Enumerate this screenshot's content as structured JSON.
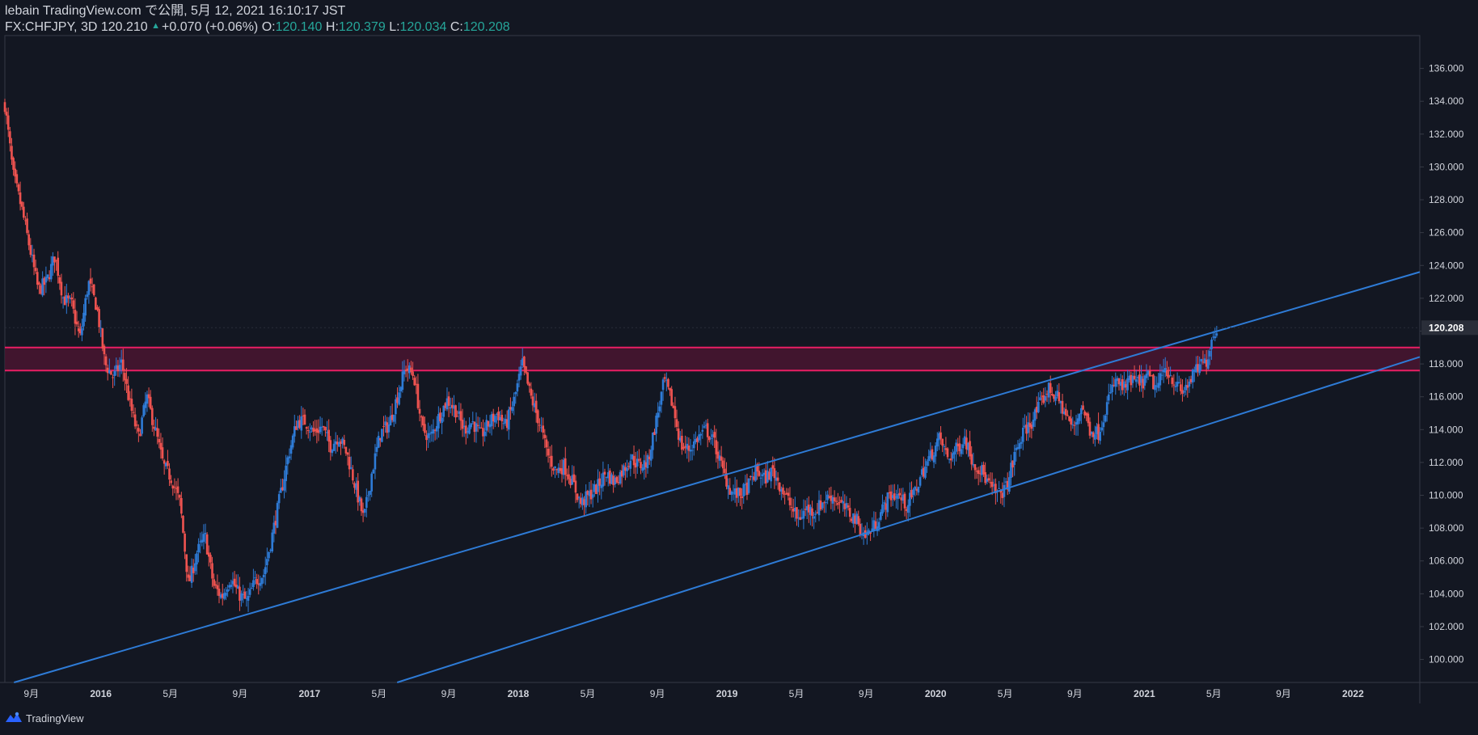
{
  "header": {
    "line1": "lebain TradingView.com で公開, 5月 12, 2021 16:10:17 JST",
    "symbol": "FX:CHFJPY, 3D",
    "price": "120.210",
    "change": "+0.070 (+0.06%)",
    "o_label": "O:",
    "o_value": "120.140",
    "h_label": "H:",
    "h_value": "120.379",
    "l_label": "L:",
    "l_value": "120.034",
    "c_label": "C:",
    "c_value": "120.208"
  },
  "footer": {
    "brand": "TradingView",
    "logo_icon": "tradingview-logo-icon"
  },
  "colors": {
    "background": "#131722",
    "up": "#2e7bd6",
    "down": "#ef5350",
    "trendline": "#2e7bd6",
    "zone_border": "#e91e63",
    "zone_fill": "#4a1530",
    "axis_text": "#d1d4dc",
    "price_tag_bg": "#2a2e39"
  },
  "chart_data": {
    "type": "candlestick",
    "symbol": "FX:CHFJPY",
    "timeframe": "3D",
    "last_price": 120.208,
    "y_axis": {
      "ticks": [
        100,
        102,
        104,
        106,
        108,
        110,
        112,
        114,
        116,
        118,
        120,
        122,
        124,
        126,
        128,
        130,
        132,
        134,
        136
      ],
      "tick_labels": [
        "100.000",
        "102.000",
        "104.000",
        "106.000",
        "108.000",
        "110.000",
        "112.000",
        "114.000",
        "116.000",
        "118.000",
        "120.000",
        "122.000",
        "124.000",
        "126.000",
        "128.000",
        "130.000",
        "132.000",
        "134.000",
        "136.000"
      ],
      "range": [
        98.6,
        138.0
      ]
    },
    "x_axis": {
      "range": [
        2015.54,
        2022.32
      ],
      "ticks": [
        {
          "t": 2015.667,
          "label": "9月"
        },
        {
          "t": 2016.0,
          "label": "2016"
        },
        {
          "t": 2016.333,
          "label": "5月"
        },
        {
          "t": 2016.667,
          "label": "9月"
        },
        {
          "t": 2017.0,
          "label": "2017"
        },
        {
          "t": 2017.333,
          "label": "5月"
        },
        {
          "t": 2017.667,
          "label": "9月"
        },
        {
          "t": 2018.0,
          "label": "2018"
        },
        {
          "t": 2018.333,
          "label": "5月"
        },
        {
          "t": 2018.667,
          "label": "9月"
        },
        {
          "t": 2019.0,
          "label": "2019"
        },
        {
          "t": 2019.333,
          "label": "5月"
        },
        {
          "t": 2019.667,
          "label": "9月"
        },
        {
          "t": 2020.0,
          "label": "2020"
        },
        {
          "t": 2020.333,
          "label": "5月"
        },
        {
          "t": 2020.667,
          "label": "9月"
        },
        {
          "t": 2021.0,
          "label": "2021"
        },
        {
          "t": 2021.333,
          "label": "5月"
        },
        {
          "t": 2021.667,
          "label": "9月"
        },
        {
          "t": 2022.0,
          "label": "2022"
        }
      ]
    },
    "resistance_zone": {
      "low": 117.6,
      "high": 119.0
    },
    "trendlines": [
      {
        "name": "upper",
        "p1": {
          "t": 2016.5,
          "v": 102.0
        },
        "p2": {
          "t": 2021.35,
          "v": 120.0
        }
      },
      {
        "name": "lower",
        "p1": {
          "t": 2017.42,
          "v": 98.6
        },
        "p2": {
          "t": 2021.35,
          "v": 114.5
        }
      }
    ],
    "close_path": [
      [
        2015.54,
        133.8
      ],
      [
        2015.58,
        129.5
      ],
      [
        2015.62,
        127.5
      ],
      [
        2015.66,
        125.0
      ],
      [
        2015.7,
        122.5
      ],
      [
        2015.74,
        123.0
      ],
      [
        2015.78,
        124.6
      ],
      [
        2015.82,
        122.0
      ],
      [
        2015.86,
        121.6
      ],
      [
        2015.9,
        119.5
      ],
      [
        2015.94,
        123.0
      ],
      [
        2015.98,
        121.5
      ],
      [
        2016.02,
        118.0
      ],
      [
        2016.06,
        117.2
      ],
      [
        2016.1,
        118.1
      ],
      [
        2016.14,
        115.5
      ],
      [
        2016.18,
        113.5
      ],
      [
        2016.22,
        116.0
      ],
      [
        2016.26,
        114.0
      ],
      [
        2016.3,
        111.8
      ],
      [
        2016.34,
        111.0
      ],
      [
        2016.38,
        109.5
      ],
      [
        2016.42,
        104.5
      ],
      [
        2016.46,
        106.5
      ],
      [
        2016.5,
        107.5
      ],
      [
        2016.54,
        104.5
      ],
      [
        2016.58,
        103.8
      ],
      [
        2016.62,
        105.0
      ],
      [
        2016.66,
        104.0
      ],
      [
        2016.7,
        103.5
      ],
      [
        2016.74,
        104.8
      ],
      [
        2016.78,
        105.2
      ],
      [
        2016.82,
        107.5
      ],
      [
        2016.86,
        110.0
      ],
      [
        2016.9,
        112.5
      ],
      [
        2016.94,
        114.5
      ],
      [
        2016.98,
        114.5
      ],
      [
        2017.02,
        113.8
      ],
      [
        2017.06,
        114.2
      ],
      [
        2017.1,
        113.0
      ],
      [
        2017.14,
        113.6
      ],
      [
        2017.18,
        112.5
      ],
      [
        2017.22,
        110.5
      ],
      [
        2017.26,
        108.5
      ],
      [
        2017.3,
        111.5
      ],
      [
        2017.34,
        113.8
      ],
      [
        2017.38,
        114.3
      ],
      [
        2017.42,
        116.0
      ],
      [
        2017.46,
        117.8
      ],
      [
        2017.5,
        117.3
      ],
      [
        2017.54,
        114.0
      ],
      [
        2017.58,
        113.5
      ],
      [
        2017.62,
        114.8
      ],
      [
        2017.66,
        115.8
      ],
      [
        2017.7,
        115.2
      ],
      [
        2017.74,
        114.0
      ],
      [
        2017.78,
        114.5
      ],
      [
        2017.82,
        113.6
      ],
      [
        2017.86,
        114.4
      ],
      [
        2017.9,
        115.0
      ],
      [
        2017.94,
        114.2
      ],
      [
        2017.98,
        115.8
      ],
      [
        2018.02,
        118.0
      ],
      [
        2018.06,
        116.0
      ],
      [
        2018.1,
        114.5
      ],
      [
        2018.14,
        112.5
      ],
      [
        2018.18,
        111.5
      ],
      [
        2018.22,
        111.8
      ],
      [
        2018.26,
        110.8
      ],
      [
        2018.3,
        109.5
      ],
      [
        2018.34,
        110.0
      ],
      [
        2018.38,
        110.5
      ],
      [
        2018.42,
        111.4
      ],
      [
        2018.46,
        110.8
      ],
      [
        2018.5,
        111.5
      ],
      [
        2018.54,
        112.3
      ],
      [
        2018.58,
        111.8
      ],
      [
        2018.62,
        112.0
      ],
      [
        2018.66,
        114.5
      ],
      [
        2018.7,
        117.0
      ],
      [
        2018.74,
        115.5
      ],
      [
        2018.78,
        113.0
      ],
      [
        2018.82,
        112.8
      ],
      [
        2018.86,
        113.5
      ],
      [
        2018.9,
        114.0
      ],
      [
        2018.94,
        113.2
      ],
      [
        2018.98,
        111.5
      ],
      [
        2019.02,
        110.2
      ],
      [
        2019.06,
        110.0
      ],
      [
        2019.1,
        110.5
      ],
      [
        2019.14,
        111.5
      ],
      [
        2019.18,
        111.0
      ],
      [
        2019.22,
        111.5
      ],
      [
        2019.26,
        110.5
      ],
      [
        2019.3,
        109.5
      ],
      [
        2019.34,
        108.5
      ],
      [
        2019.38,
        109.2
      ],
      [
        2019.42,
        109.0
      ],
      [
        2019.46,
        109.6
      ],
      [
        2019.5,
        110.0
      ],
      [
        2019.54,
        109.5
      ],
      [
        2019.58,
        109.0
      ],
      [
        2019.62,
        108.5
      ],
      [
        2019.66,
        107.5
      ],
      [
        2019.7,
        108.0
      ],
      [
        2019.74,
        109.0
      ],
      [
        2019.78,
        110.0
      ],
      [
        2019.82,
        110.0
      ],
      [
        2019.86,
        109.4
      ],
      [
        2019.9,
        110.2
      ],
      [
        2019.94,
        111.5
      ],
      [
        2019.98,
        112.5
      ],
      [
        2020.02,
        113.5
      ],
      [
        2020.06,
        112.2
      ],
      [
        2020.1,
        112.8
      ],
      [
        2020.14,
        113.5
      ],
      [
        2020.18,
        112.0
      ],
      [
        2020.22,
        111.5
      ],
      [
        2020.26,
        110.5
      ],
      [
        2020.3,
        110.0
      ],
      [
        2020.34,
        110.5
      ],
      [
        2020.38,
        112.5
      ],
      [
        2020.42,
        113.8
      ],
      [
        2020.46,
        114.5
      ],
      [
        2020.5,
        115.5
      ],
      [
        2020.54,
        116.5
      ],
      [
        2020.58,
        116.0
      ],
      [
        2020.62,
        115.0
      ],
      [
        2020.66,
        114.0
      ],
      [
        2020.7,
        115.5
      ],
      [
        2020.74,
        114.0
      ],
      [
        2020.78,
        113.8
      ],
      [
        2020.82,
        115.5
      ],
      [
        2020.86,
        117.0
      ],
      [
        2020.9,
        116.5
      ],
      [
        2020.94,
        117.0
      ],
      [
        2020.98,
        116.8
      ],
      [
        2021.02,
        117.2
      ],
      [
        2021.06,
        116.5
      ],
      [
        2021.1,
        117.8
      ],
      [
        2021.14,
        117.0
      ],
      [
        2021.18,
        116.2
      ],
      [
        2021.22,
        117.0
      ],
      [
        2021.26,
        117.8
      ],
      [
        2021.3,
        118.2
      ],
      [
        2021.32,
        119.5
      ],
      [
        2021.35,
        120.2
      ]
    ]
  }
}
